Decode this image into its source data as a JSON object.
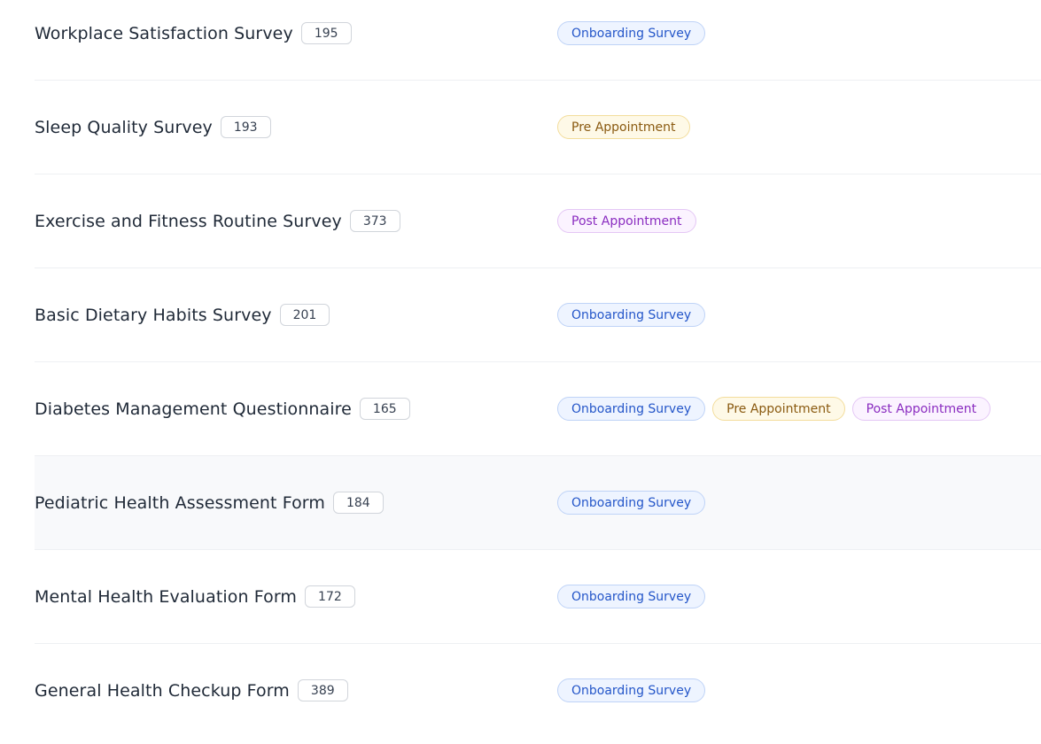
{
  "surveys": [
    {
      "name": "Workplace Satisfaction Survey",
      "count": "195",
      "tags": [
        {
          "label": "Onboarding Survey",
          "kind": "onboarding"
        }
      ]
    },
    {
      "name": "Sleep Quality Survey",
      "count": "193",
      "tags": [
        {
          "label": "Pre Appointment",
          "kind": "pre"
        }
      ]
    },
    {
      "name": "Exercise and Fitness Routine Survey",
      "count": "373",
      "tags": [
        {
          "label": "Post Appointment",
          "kind": "post"
        }
      ]
    },
    {
      "name": "Basic Dietary Habits Survey",
      "count": "201",
      "tags": [
        {
          "label": "Onboarding Survey",
          "kind": "onboarding"
        }
      ]
    },
    {
      "name": "Diabetes Management Questionnaire",
      "count": "165",
      "tags": [
        {
          "label": "Onboarding Survey",
          "kind": "onboarding"
        },
        {
          "label": "Pre Appointment",
          "kind": "pre"
        },
        {
          "label": "Post Appointment",
          "kind": "post"
        }
      ]
    },
    {
      "name": "Pediatric Health Assessment Form",
      "count": "184",
      "highlighted": true,
      "tags": [
        {
          "label": "Onboarding Survey",
          "kind": "onboarding"
        }
      ]
    },
    {
      "name": "Mental Health Evaluation Form",
      "count": "172",
      "tags": [
        {
          "label": "Onboarding Survey",
          "kind": "onboarding"
        }
      ]
    },
    {
      "name": "General Health Checkup Form",
      "count": "389",
      "tags": [
        {
          "label": "Onboarding Survey",
          "kind": "onboarding"
        }
      ]
    }
  ],
  "colors": {
    "onboarding_text": "#2456c9",
    "pre_text": "#8a5a10",
    "post_text": "#8a2cc0",
    "row_highlight": "#f8f9fb"
  }
}
